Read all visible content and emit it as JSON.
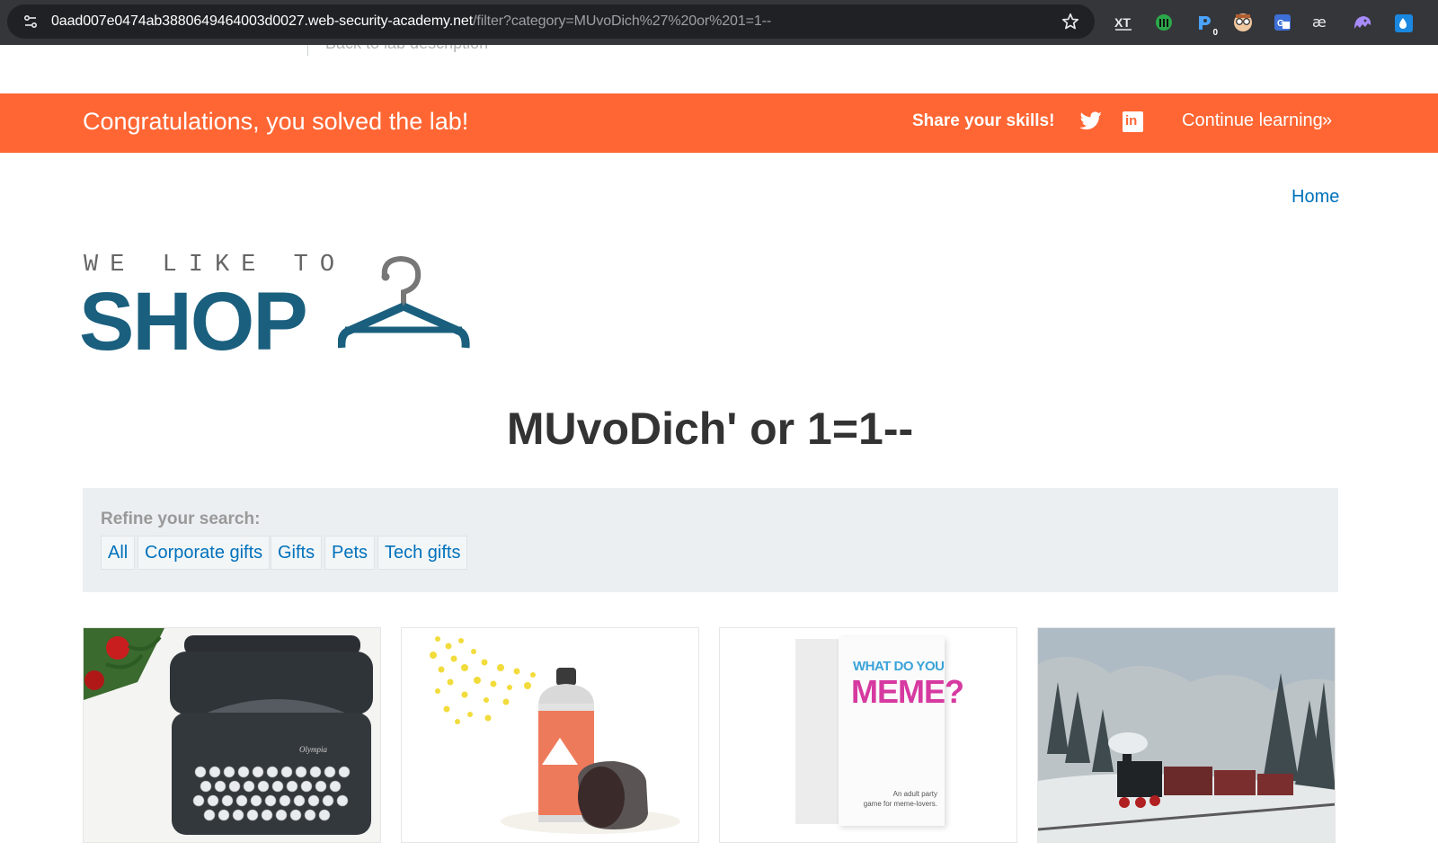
{
  "browser": {
    "url_host": "0aad007e0474ab3880649464003d0027.web-security-academy.net",
    "url_path": "/filter?category=MUvoDich%27%20or%201=1--",
    "extension_badge": "0",
    "extensions": [
      "translate-icon",
      "monster-icon",
      "wallet-icon",
      "glasses-icon",
      "translate-square-icon",
      "ae-icon",
      "ghost-icon",
      "dropper-icon"
    ]
  },
  "header": {
    "back_link": "Back to lab description"
  },
  "banner": {
    "message": "Congratulations, you solved the lab!",
    "share": "Share your skills!",
    "linkedin": "in",
    "continue": "Continue learning",
    "continue_chevron": "»"
  },
  "nav": {
    "home": "Home"
  },
  "logo": {
    "top": "WE LIKE TO",
    "main": "SHOP"
  },
  "category_title": "MUvoDich' or 1=1--",
  "refine": {
    "label": "Refine your search:",
    "filters": [
      "All",
      "Corporate gifts",
      "Gifts",
      "Pets",
      "Tech gifts"
    ]
  },
  "products": {
    "meme_line1": "WHAT DO YOU",
    "meme_line2": "MEME?",
    "meme_sub1": "An adult party",
    "meme_sub2": "game for meme-lovers."
  },
  "colors": {
    "banner": "#ff6633",
    "link": "#0071bc",
    "logo": "#1a5f7e"
  }
}
